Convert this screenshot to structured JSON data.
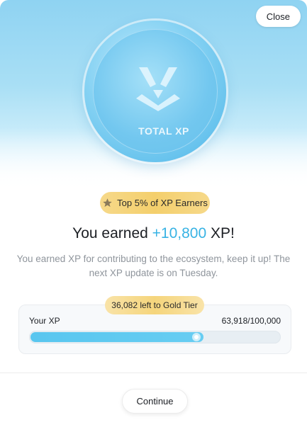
{
  "modal": {
    "close_label": "Close",
    "coin_label": "TOTAL XP",
    "badge": {
      "icon": "star-icon",
      "label": "Top 5% of XP Earners"
    },
    "headline": {
      "prefix": "You earned ",
      "amount": "+10,800",
      "suffix": " XP!"
    },
    "description": "You earned XP for contributing to the ecosystem, keep it up! The next XP update is on Tuesday.",
    "xp": {
      "tier_pill": "36,082 left to Gold Tier",
      "label": "Your XP",
      "value_text": "63,918/100,000",
      "current": 63918,
      "max": 100000
    },
    "continue_label": "Continue"
  },
  "colors": {
    "accent": "#38b3e4",
    "gold": "#f4cf6c",
    "progress": "#58c6ef"
  }
}
